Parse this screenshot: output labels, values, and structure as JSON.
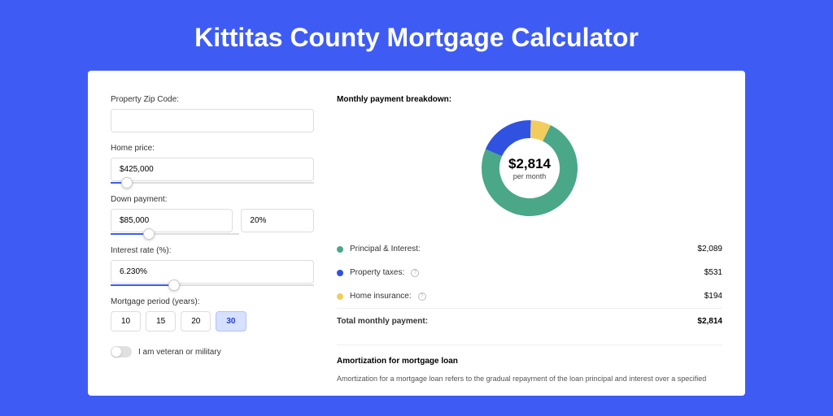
{
  "title": "Kittitas County Mortgage Calculator",
  "form": {
    "zip_label": "Property Zip Code:",
    "zip_value": "",
    "price_label": "Home price:",
    "price_value": "$425,000",
    "price_slider_pct": 8,
    "down_label": "Down payment:",
    "down_value": "$85,000",
    "down_pct_value": "20%",
    "down_slider_pct": 20,
    "rate_label": "Interest rate (%):",
    "rate_value": "6.230%",
    "rate_slider_pct": 31,
    "period_label": "Mortgage period (years):",
    "periods": [
      "10",
      "15",
      "20",
      "30"
    ],
    "period_selected": "30",
    "veteran_label": "I am veteran or military"
  },
  "breakdown": {
    "title": "Monthly payment breakdown:",
    "center_amount": "$2,814",
    "center_sub": "per month",
    "items": [
      {
        "label": "Principal & Interest:",
        "value": "$2,089",
        "color": "green",
        "info": false
      },
      {
        "label": "Property taxes:",
        "value": "$531",
        "color": "blue",
        "info": true
      },
      {
        "label": "Home insurance:",
        "value": "$194",
        "color": "yellow",
        "info": true
      }
    ],
    "total_label": "Total monthly payment:",
    "total_value": "$2,814"
  },
  "chart_data": {
    "type": "pie",
    "title": "Monthly payment breakdown",
    "segments": [
      {
        "name": "Principal & Interest",
        "value": 2089,
        "color": "#4aa788"
      },
      {
        "name": "Property taxes",
        "value": 531,
        "color": "#3052e0"
      },
      {
        "name": "Home insurance",
        "value": 194,
        "color": "#f2cd5d"
      }
    ],
    "total": 2814,
    "unit": "USD per month"
  },
  "amort": {
    "title": "Amortization for mortgage loan",
    "text": "Amortization for a mortgage loan refers to the gradual repayment of the loan principal and interest over a specified"
  }
}
